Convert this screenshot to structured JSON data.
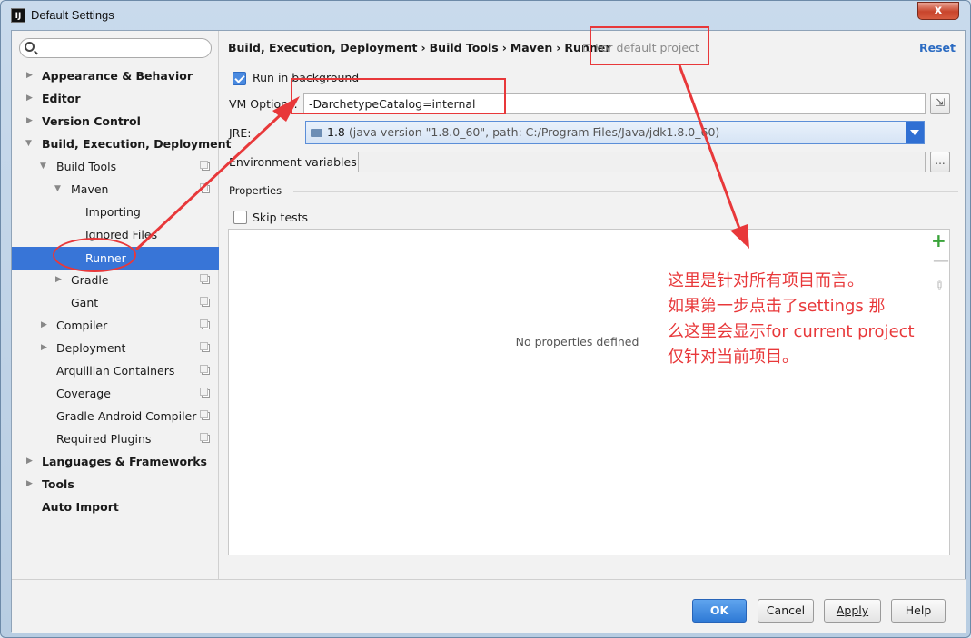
{
  "window": {
    "title": "Default Settings",
    "app_icon": "IJ",
    "close": "x"
  },
  "search": {
    "placeholder": "",
    "value": ""
  },
  "sidebar": {
    "items": [
      {
        "label": "Appearance & Behavior"
      },
      {
        "label": "Editor"
      },
      {
        "label": "Version Control"
      },
      {
        "label": "Build, Execution, Deployment"
      },
      {
        "label": "Build Tools"
      },
      {
        "label": "Maven"
      },
      {
        "label": "Importing"
      },
      {
        "label": "Ignored Files"
      },
      {
        "label": "Runner"
      },
      {
        "label": "Gradle"
      },
      {
        "label": "Gant"
      },
      {
        "label": "Compiler"
      },
      {
        "label": "Deployment"
      },
      {
        "label": "Arquillian Containers"
      },
      {
        "label": "Coverage"
      },
      {
        "label": "Gradle-Android Compiler"
      },
      {
        "label": "Required Plugins"
      },
      {
        "label": "Languages & Frameworks"
      },
      {
        "label": "Tools"
      },
      {
        "label": "Auto Import"
      }
    ]
  },
  "header": {
    "breadcrumb": [
      "Build, Execution, Deployment",
      "Build Tools",
      "Maven",
      "Runner"
    ],
    "separator": "›",
    "scope": "For default project",
    "reset": "Reset"
  },
  "form": {
    "run_in_background": {
      "label": "Run in background",
      "checked": true
    },
    "vm_options": {
      "label": "VM Options:",
      "value": "-DarchetypeCatalog=internal"
    },
    "jre": {
      "label": "JRE:",
      "version": "1.8",
      "path": "(java version \"1.8.0_60\", path: C:/Program Files/Java/jdk1.8.0_60)"
    },
    "env_vars": {
      "label": "Environment variables:",
      "value": "",
      "button": "..."
    },
    "properties_title": "Properties",
    "skip_tests": {
      "label": "Skip tests",
      "checked": false
    },
    "empty_message": "No properties defined",
    "toolbar": {
      "add": "+",
      "remove": "—",
      "edit": "✎"
    }
  },
  "footer": {
    "ok": "OK",
    "cancel": "Cancel",
    "apply": "Apply",
    "help": "Help"
  },
  "annotation": {
    "lines": [
      "这里是针对所有项目而言。",
      "如果第一步点击了settings 那",
      "么这里会显示for current project",
      "仅针对当前项目。"
    ],
    "color": "#e8383a"
  },
  "colors": {
    "selection": "#3875d7",
    "primary_button": "#2f7ad6",
    "link": "#2b6bc2"
  }
}
